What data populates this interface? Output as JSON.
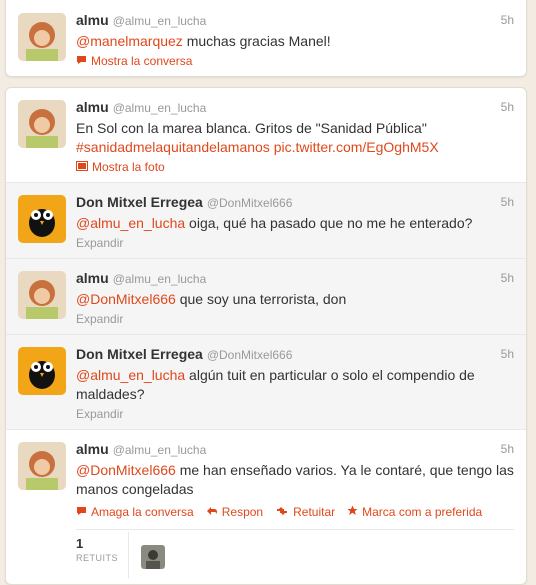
{
  "tweets_top": [
    {
      "fullname": "almu",
      "username": "@almu_en_lucha",
      "time": "5h",
      "mention": "@manelmarquez",
      "text": " muchas gracias Manel!",
      "action": "Mostra la conversa"
    }
  ],
  "thread": [
    {
      "fullname": "almu",
      "username": "@almu_en_lucha",
      "time": "5h",
      "text1": "En Sol con la marea blanca. Gritos de \"Sanidad Pública\"",
      "hashtag": "#sanidadmelaquitandelamanos",
      "piclink": "pic.twitter.com/EgOghM5X",
      "action": "Mostra la foto"
    },
    {
      "fullname": "Don Mitxel Erregea",
      "username": "@DonMitxel666",
      "time": "5h",
      "mention": "@almu_en_lucha",
      "text": " oiga, qué ha pasado que no me he enterado?",
      "action": "Expandir"
    },
    {
      "fullname": "almu",
      "username": "@almu_en_lucha",
      "time": "5h",
      "mention": "@DonMitxel666",
      "text": " que soy una terrorista, don",
      "action": "Expandir"
    },
    {
      "fullname": "Don Mitxel Erregea",
      "username": "@DonMitxel666",
      "time": "5h",
      "mention": "@almu_en_lucha",
      "text": " algún tuit en particular o solo el compendio de maldades?",
      "action": "Expandir"
    },
    {
      "fullname": "almu",
      "username": "@almu_en_lucha",
      "time": "5h",
      "mention": "@DonMitxel666",
      "text": " me han enseñado varios. Ya le contaré, que tengo las manos congeladas",
      "actions": {
        "hide": "Amaga la conversa",
        "reply": "Respon",
        "retweet": "Retuitar",
        "favorite": "Marca com a preferida"
      },
      "stats": {
        "retweets": "1",
        "retweets_label": "RETUITS"
      }
    }
  ],
  "colors": {
    "accent": "#e0481c",
    "muted": "#999999",
    "background": "#f3ece2"
  }
}
